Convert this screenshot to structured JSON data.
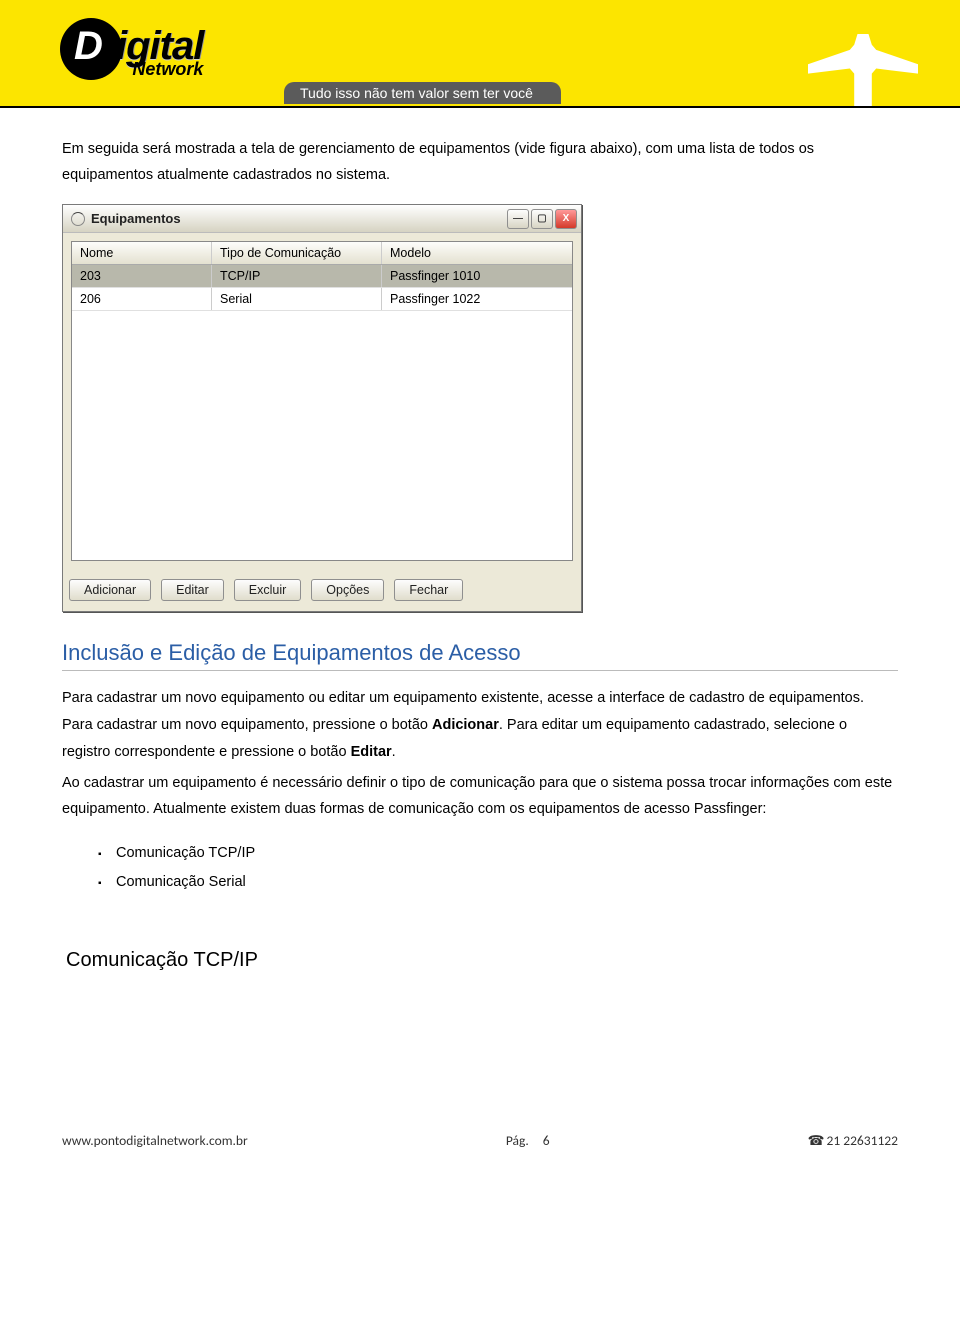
{
  "banner": {
    "logo_word1": "igital",
    "logo_word2": "Network",
    "slogan": "Tudo isso não tem valor sem ter você"
  },
  "intro": "Em seguida será mostrada a tela de gerenciamento de equipamentos (vide figura abaixo), com uma lista de todos os equipamentos atualmente cadastrados no sistema.",
  "dialog": {
    "title": "Equipamentos",
    "columns": {
      "c1": "Nome",
      "c2": "Tipo de Comunicação",
      "c3": "Modelo"
    },
    "rows": [
      {
        "c1": "203",
        "c2": "TCP/IP",
        "c3": "Passfinger 1010"
      },
      {
        "c1": "206",
        "c2": "Serial",
        "c3": "Passfinger 1022"
      }
    ],
    "buttons": {
      "add": "Adicionar",
      "edit": "Editar",
      "del": "Excluir",
      "opt": "Opções",
      "close": "Fechar"
    }
  },
  "section_title": "Inclusão e Edição de Equipamentos de Acesso",
  "section_body_1a": "Para cadastrar um novo equipamento ou editar um equipamento existente, acesse a interface de cadastro de equipamentos. Para cadastrar um novo equipamento, pressione o botão ",
  "section_body_1b": "Adicionar",
  "section_body_1c": ". Para editar um equipamento cadastrado, selecione o registro correspondente e pressione o botão ",
  "section_body_1d": "Editar",
  "section_body_1e": ".",
  "section_body_2": "Ao cadastrar um equipamento é necessário definir o tipo de comunicação para que o sistema possa trocar informações com este equipamento. Atualmente existem duas formas de comunicação com os equipamentos de acesso Passfinger:",
  "bullets": {
    "b1": "Comunicação TCP/IP",
    "b2": "Comunicação Serial"
  },
  "subsection": "Comunicação TCP/IP",
  "footer": {
    "url": "www.pontodigitalnetwork.com.br",
    "page_label": "Pág.",
    "page_num": "6",
    "phone": "21 22631122"
  }
}
